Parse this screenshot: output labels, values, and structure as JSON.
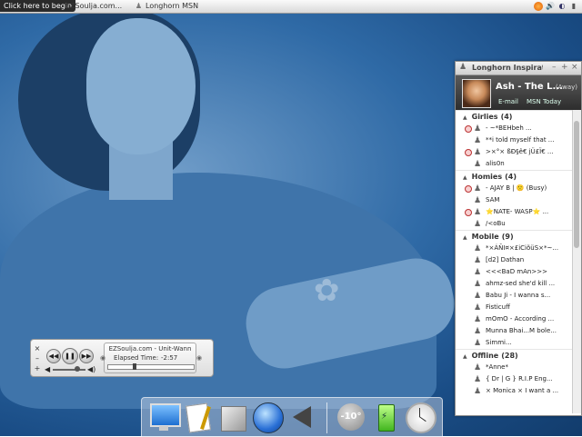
{
  "taskbar": {
    "start_label": "Click here to begin",
    "tasks": [
      {
        "label": "EZSoulja.com...",
        "icon": "document-icon"
      },
      {
        "label": "Longhorn MSN",
        "icon": "buddy-icon"
      }
    ],
    "tray_icons": [
      "firefox-icon",
      "volume-icon",
      "shield-icon",
      "network-icon",
      "clock-icon"
    ]
  },
  "messenger": {
    "title": "Longhorn Inspirat",
    "user": {
      "name": "Ash - The L...",
      "status": "(Away)",
      "email_link": "E-mail",
      "today_link": "MSN Today"
    },
    "groups": [
      {
        "name": "Girlies",
        "count": "(4)",
        "contacts": [
          {
            "text": "-      ~*BEHbeh        ...",
            "blocked": true
          },
          {
            "text": "**i told myself that ...",
            "blocked": false
          },
          {
            "text": ">×°× ßÐ§ê€ јÜ£Ï€ ...",
            "blocked": true
          },
          {
            "text": "alis0n",
            "blocked": false
          }
        ]
      },
      {
        "name": "Homies",
        "count": "(4)",
        "contacts": [
          {
            "text": "- AJAY B | 🙁 (Busy)",
            "blocked": true
          },
          {
            "text": "SAM",
            "blocked": false
          },
          {
            "text": "⭐NATE- WASP⭐ ...",
            "blocked": true
          },
          {
            "text": "/<oBu",
            "blocked": false
          }
        ]
      },
      {
        "name": "Mobile",
        "count": "(9)",
        "contacts": [
          {
            "text": "*×ÁÑI¤×£iCiõüS×*~...",
            "blocked": false
          },
          {
            "text": "[d2] Dathan",
            "blocked": false
          },
          {
            "text": "<<<BaD mAn>>>",
            "blocked": false
          },
          {
            "text": "ahmz-sed she'd kill ...",
            "blocked": false
          },
          {
            "text": "Babu Ji - I wanna s...",
            "blocked": false
          },
          {
            "text": "Fisticuff",
            "blocked": false
          },
          {
            "text": "mOmO - According ...",
            "blocked": false
          },
          {
            "text": "Munna Bhai...M bole...",
            "blocked": false
          },
          {
            "text": "Simmi...",
            "blocked": false
          }
        ]
      },
      {
        "name": "Offline",
        "count": "(28)",
        "contacts": [
          {
            "text": "*Anne*",
            "blocked": false
          },
          {
            "text": "{ Dr | G } R.I.P Eng...",
            "blocked": false
          },
          {
            "text": "× Monica × I want a ...",
            "blocked": false
          }
        ]
      }
    ]
  },
  "player": {
    "track_title": "EZSoulja.com - Unit-Wann",
    "elapsed_label": "Elapsed Time:",
    "elapsed_value": "-2:57",
    "progress_fraction": 0.3,
    "volume_fraction": 0.8,
    "side_buttons": [
      "×",
      "–",
      "+"
    ]
  },
  "dock": {
    "items": [
      "monitor-icon",
      "preview-icon",
      "package-icon",
      "network-globe-icon",
      "speaker-icon",
      "weather-moon-icon",
      "battery-icon",
      "clock-icon"
    ],
    "moon_label": "-10°"
  }
}
